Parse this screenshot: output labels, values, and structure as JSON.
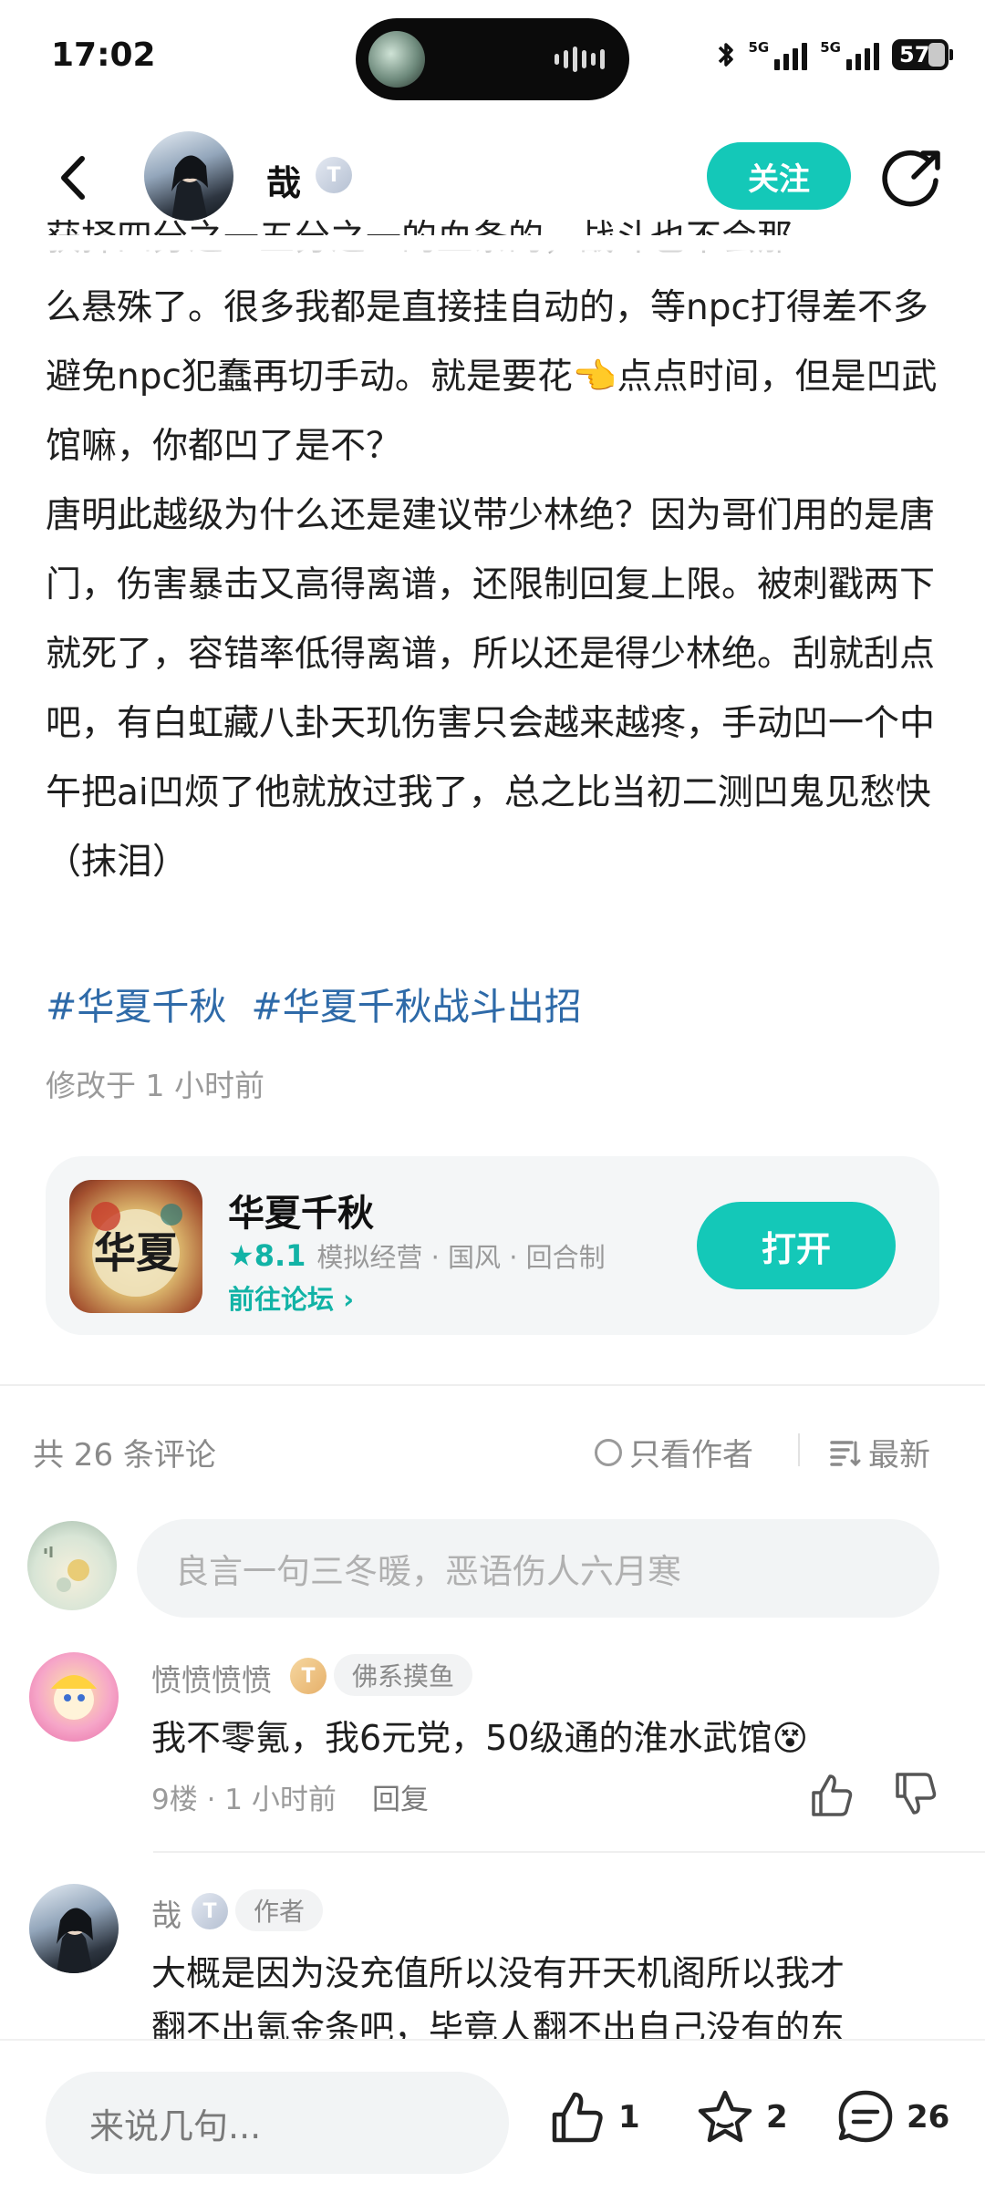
{
  "status_bar": {
    "time": "17:02",
    "network_1": "5G",
    "network_2": "5G",
    "battery": "57"
  },
  "header": {
    "author_name": "哉",
    "level_badge": "T",
    "follow_label": "关注"
  },
  "article": {
    "lines_partial_top": "获择四分之一五分之一的血条的，战斗也不会那",
    "paragraphs": [
      "么悬殊了。很多我都是直接挂自动的，等npc打得差不多避免npc犯蠢再切手动。就是要花👈点点时间，但是凹武馆嘛，你都凹了是不？",
      "唐明此越级为什么还是建议带少林绝？因为哥们用的是唐门，伤害暴击又高得离谱，还限制回复上限。被刺戳两下就死了，容错率低得离谱，所以还是得少林绝。刮就刮点吧，有白虹藏八卦天玑伤害只会越来越疼，手动凹一个中午把ai凹烦了他就放过我了，总之比当初二测凹鬼见愁快（抹泪）"
    ],
    "tags": [
      "#华夏千秋",
      "#华夏千秋战斗出招"
    ],
    "modified": "修改于 1 小时前"
  },
  "game_card": {
    "title": "华夏千秋",
    "score": "8.1",
    "genres": "模拟经营 · 国风 · 回合制",
    "forum_link": "前往论坛",
    "open_label": "打开",
    "icon_text": "华夏"
  },
  "comments_header": {
    "count": "共 26 条评论",
    "only_author": "只看作者",
    "sort": "最新",
    "input_placeholder": "良言一句三冬暖，恶语伤人六月寒"
  },
  "comments": [
    {
      "name": "愤愤愤愤",
      "tag": "佛系摸鱼",
      "text": "我不零氪，我6元党，50级通的淮水武馆😵",
      "meta": "9楼 · 1 小时前",
      "reply": "回复"
    },
    {
      "name": "哉",
      "tag": "作者",
      "text_line1": "大概是因为没充值所以没有开天机阁所以我才",
      "text_line2": "翻不出氪金条吧，毕竟人翻不出自己没有的东"
    }
  ],
  "bottom_bar": {
    "placeholder": "来说几句...",
    "likes": "1",
    "favorites": "2",
    "comments": "26"
  },
  "colors": {
    "accent": "#14c8b8",
    "tag_blue": "#2e6aa8"
  }
}
